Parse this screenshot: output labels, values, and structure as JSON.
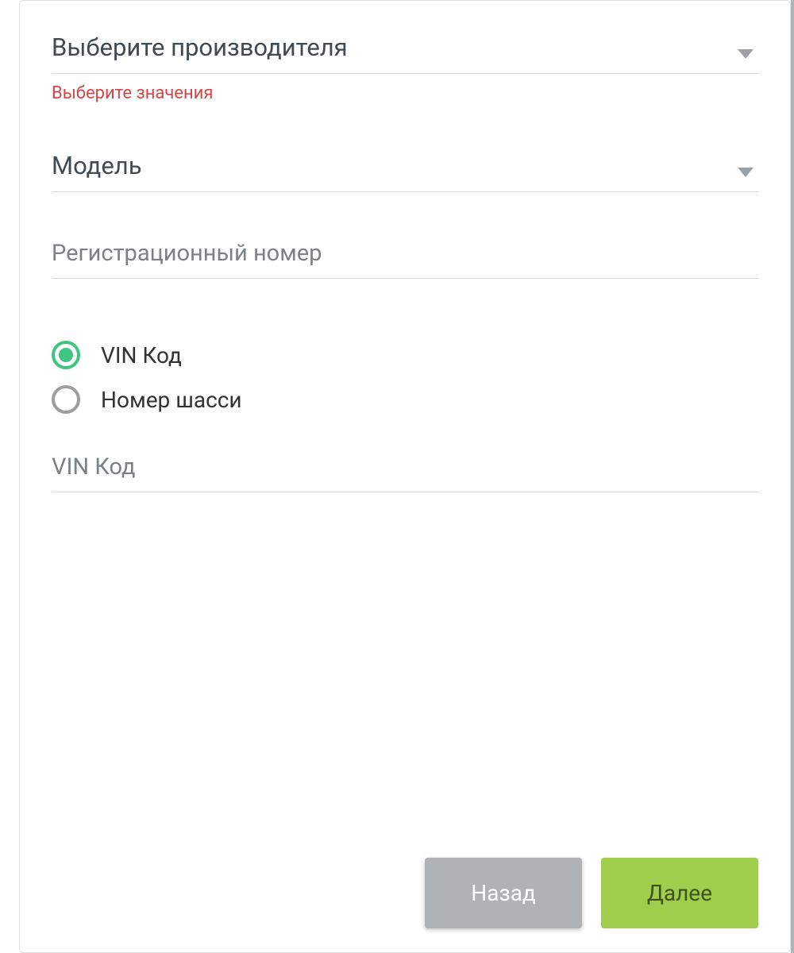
{
  "form": {
    "manufacturer": {
      "label": "Выберите производителя",
      "error": "Выберите значения"
    },
    "model": {
      "label": "Модель"
    },
    "registration": {
      "placeholder": "Регистрационный номер"
    },
    "idType": {
      "options": {
        "vin": "VIN Код",
        "chassis": "Номер шасси"
      }
    },
    "vinField": {
      "placeholder": "VIN Код"
    }
  },
  "buttons": {
    "back": "Назад",
    "next": "Далее"
  }
}
